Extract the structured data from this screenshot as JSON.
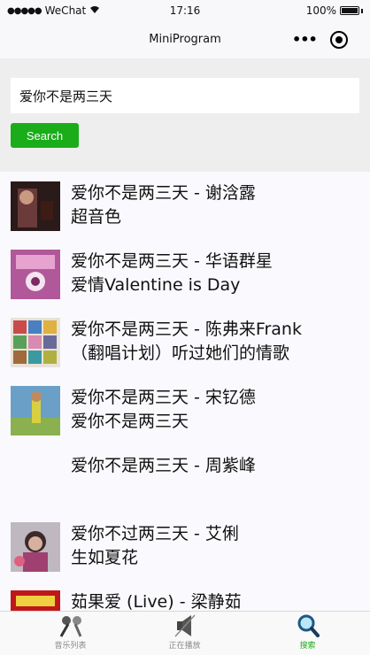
{
  "status": {
    "carrier": "WeChat",
    "time": "17:16",
    "battery": "100%"
  },
  "nav": {
    "title": "MiniProgram"
  },
  "search": {
    "value": "爱你不是两三天",
    "button": "Search"
  },
  "results": [
    {
      "line1": "爱你不是两三天 - 谢浛露",
      "line2": "超音色",
      "cover": "cover-1"
    },
    {
      "line1": "爱你不是两三天 - 华语群星",
      "line2": "爱情Valentine is Day",
      "cover": "cover-2"
    },
    {
      "line1": "爱你不是两三天 - 陈弗来Frank",
      "line2": "（翻唱计划）听过她们的情歌",
      "cover": "cover-3"
    },
    {
      "line1": "爱你不是两三天 - 宋钇德",
      "line2": "爱你不是两三天",
      "cover": "cover-4"
    },
    {
      "line1": "爱你不是两三天 - 周紫峰",
      "line2": "",
      "cover": ""
    },
    {
      "line1": "爱你不过两三天 - 艾俐",
      "line2": "生如夏花",
      "cover": "cover-6"
    },
    {
      "line1": "茹果爱 (Live) - 梁静茹",
      "line2": "",
      "cover": "cover-7"
    }
  ],
  "tabs": [
    {
      "label": "音乐列表",
      "icon": "microphone-icon"
    },
    {
      "label": "正在播放",
      "icon": "speaker-icon"
    },
    {
      "label": "搜索",
      "icon": "magnifier-icon"
    }
  ],
  "colors": {
    "accent": "#1aad19",
    "search_bg": "#eeeeee"
  }
}
